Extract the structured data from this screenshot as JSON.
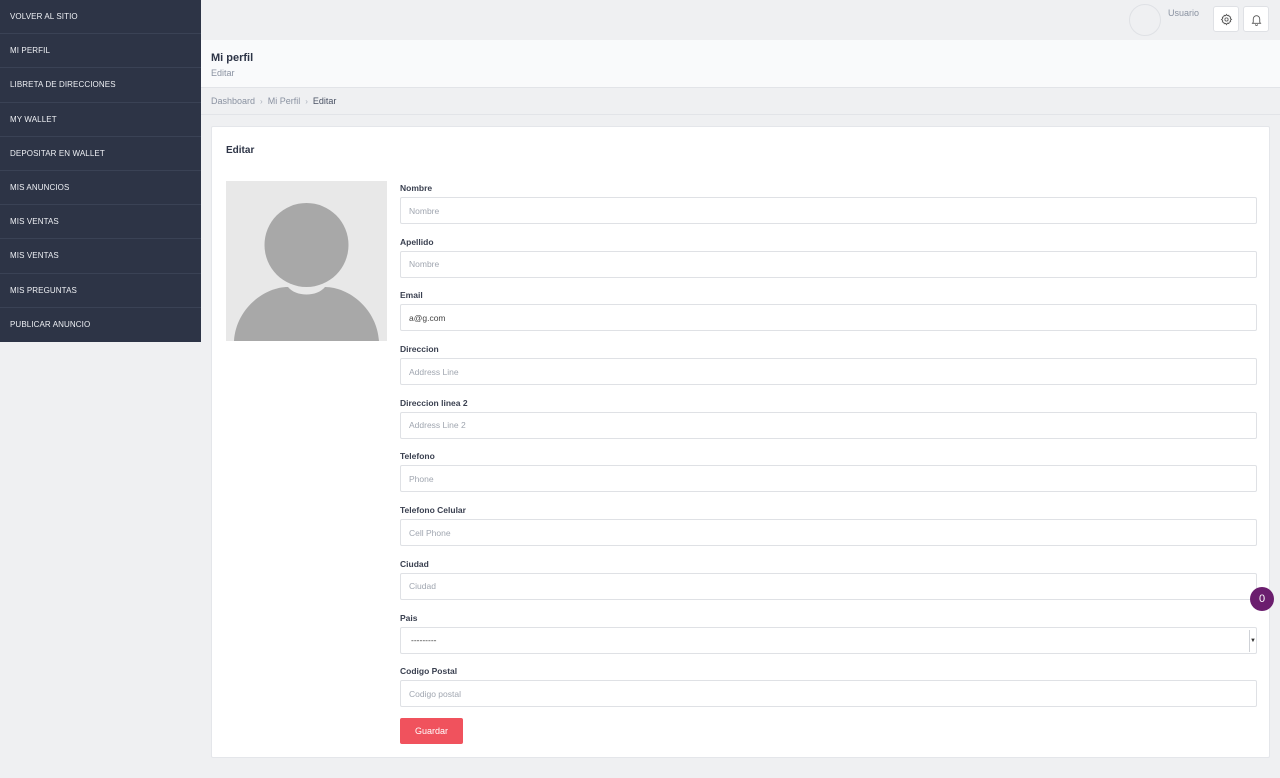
{
  "sidebar": {
    "items": [
      {
        "label": "VOLVER AL SITIO"
      },
      {
        "label": "MI PERFIL"
      },
      {
        "label": "LIBRETA DE DIRECCIONES"
      },
      {
        "label": "MY WALLET"
      },
      {
        "label": "DEPOSITAR EN WALLET"
      },
      {
        "label": "MIS ANUNCIOS"
      },
      {
        "label": "MIS VENTAS"
      },
      {
        "label": "MIS VENTAS"
      },
      {
        "label": "MIS PREGUNTAS"
      },
      {
        "label": "PUBLICAR ANUNCIO"
      }
    ]
  },
  "topbar": {
    "username": "Usuario",
    "icons": [
      "gear-icon",
      "bell-icon"
    ]
  },
  "header": {
    "title": "Mi perfil",
    "subtitle": "Editar"
  },
  "breadcrumb": {
    "items": [
      "Dashboard",
      "Mi Perfil"
    ],
    "current": "Editar"
  },
  "card": {
    "title": "Editar"
  },
  "form": {
    "fields": [
      {
        "label": "Nombre",
        "value": "",
        "placeholder": "Nombre"
      },
      {
        "label": "Apellido",
        "value": "",
        "placeholder": "Nombre"
      },
      {
        "label": "Email",
        "value": "a@g.com",
        "placeholder": ""
      },
      {
        "label": "Direccion",
        "value": "",
        "placeholder": "Address Line"
      },
      {
        "label": "Direccion linea 2",
        "value": "",
        "placeholder": "Address Line 2"
      },
      {
        "label": "Telefono",
        "value": "",
        "placeholder": "Phone"
      },
      {
        "label": "Telefono Celular",
        "value": "",
        "placeholder": "Cell Phone"
      },
      {
        "label": "Ciudad",
        "value": "",
        "placeholder": "Ciudad"
      },
      {
        "label": "Pais",
        "selected": "---------"
      },
      {
        "label": "Codigo Postal",
        "value": "",
        "placeholder": "Codigo postal"
      }
    ],
    "save_label": "Guardar"
  },
  "badge": {
    "count": "0"
  },
  "colors": {
    "sidebar_bg": "#2d3446",
    "primary_button": "#f0525d",
    "badge_bg": "#6b1e6e"
  }
}
